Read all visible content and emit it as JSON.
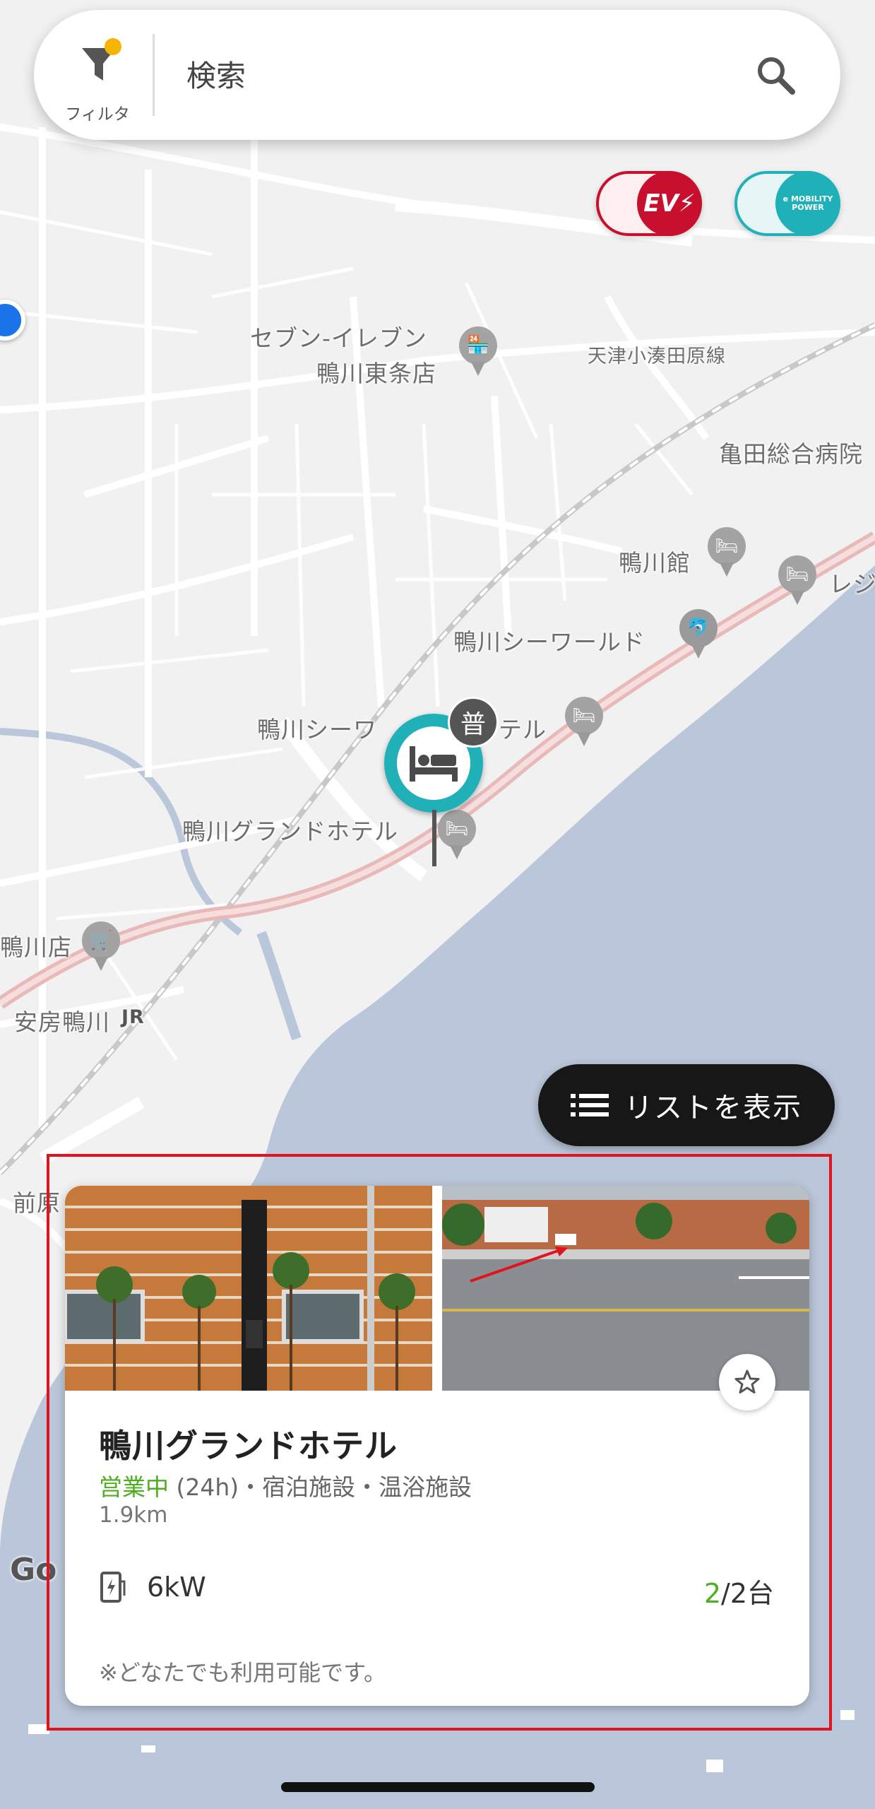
{
  "search": {
    "placeholder": "検索",
    "filter_label": "フィルタ"
  },
  "toggles": {
    "ev_label": "EV",
    "mobility_label_line1": "e MOBILITY",
    "mobility_label_line2": "POWER"
  },
  "map": {
    "labels": {
      "seven_eleven_1": "セブン-イレブン",
      "seven_eleven_2": "鴨川東条店",
      "road": "天津小湊田原線",
      "hospital": "亀田総合病院",
      "kamogawakan": "鴨川館",
      "resort": "レジ",
      "seaworld": "鴨川シーワールド",
      "seaworld_hotel_a": "鴨川シーワ",
      "seaworld_hotel_b": "テル",
      "grand_hotel": "鴨川グランドホテル",
      "store": "鴨川店",
      "station": "安房鴨川",
      "jr": "JR",
      "maebara": "前原"
    },
    "pin_badge": "普"
  },
  "list_button": {
    "label": "リストを表示"
  },
  "card": {
    "name": "鴨川グランドホテル",
    "status_open": "営業中",
    "status_rest": " (24h)・宿泊施設・温浴施設",
    "distance": "1.9km",
    "power": "6kW",
    "available": "2",
    "total": "/2台",
    "note": "※どなたでも利用可能です。"
  },
  "google_logo": "Go",
  "colors": {
    "ev_red": "#c8102e",
    "teal": "#1fb0b8",
    "open_green": "#4caf1f",
    "highlight": "#e0141e"
  }
}
